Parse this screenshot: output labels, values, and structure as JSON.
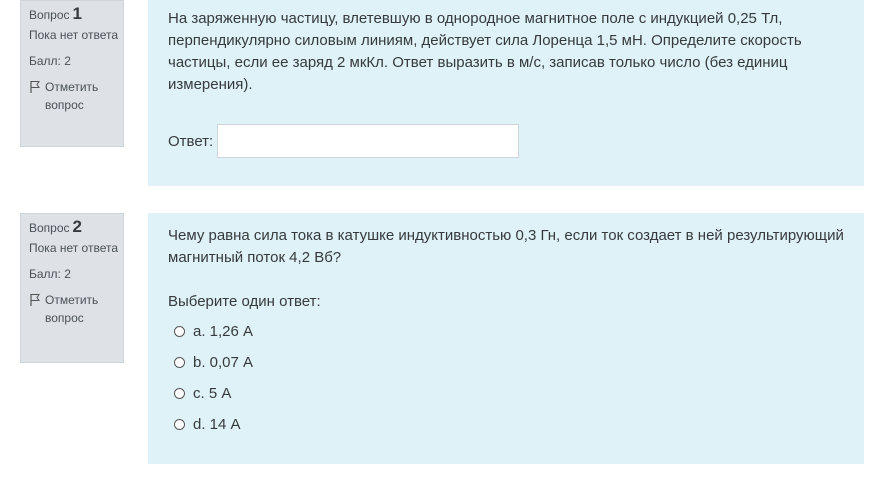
{
  "questions": [
    {
      "label": "Вопрос",
      "number": "1",
      "status": "Пока нет ответа",
      "grade": "Балл: 2",
      "flag_text": "Отметить вопрос",
      "text": "На заряженную частицу, влетевшую в однородное магнитное поле с индукцией 0,25 Тл, перпендикулярно силовым линиям, действует сила Лоренца 1,5 мН. Определите скорость частицы, если ее заряд 2 мкКл. Ответ выразить в м/с, записав только число (без единиц измерения).",
      "answer_label": "Ответ:",
      "answer_value": ""
    },
    {
      "label": "Вопрос",
      "number": "2",
      "status": "Пока нет ответа",
      "grade": "Балл: 2",
      "flag_text": "Отметить вопрос",
      "text": "Чему равна сила тока в катушке индуктивностью 0,3 Гн, если ток создает в ней результирующий магнитный поток 4,2 Вб?",
      "prompt": "Выберите один ответ:",
      "options": [
        "a. 1,26 А",
        "b. 0,07 А",
        "c. 5 А",
        "d. 14 А"
      ]
    }
  ]
}
